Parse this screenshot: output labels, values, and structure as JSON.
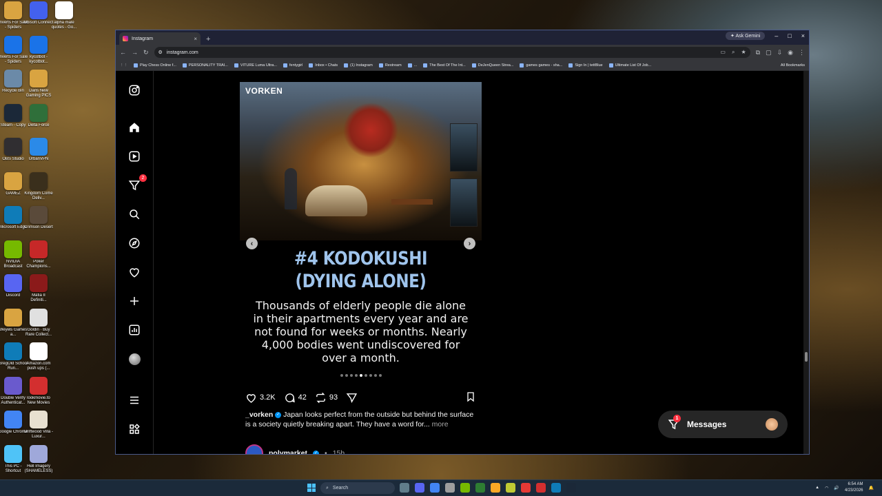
{
  "desktop": {
    "icons": [
      {
        "label": "Inverts For Sale - Spiders",
        "color": "#d9a441"
      },
      {
        "label": "Ubisoft Connect",
        "color": "#4361ee"
      },
      {
        "label": "alpha male quotes - Go...",
        "color": "#ffffff"
      },
      {
        "label": "Inverts For Sale - Spiders",
        "color": "#1a73e8"
      },
      {
        "label": "kycotbot - kycotbot...",
        "color": "#1a73e8"
      },
      {
        "label": "Recycle Bin",
        "color": "#6b8aa8"
      },
      {
        "label": "Dans New Gaming PICS",
        "color": "#d9a441"
      },
      {
        "label": "Steam - Copy",
        "color": "#1b2838"
      },
      {
        "label": "Delta Force",
        "color": "#2f6f3a"
      },
      {
        "label": "OBS Studio",
        "color": "#302e31"
      },
      {
        "label": "UrbanVPN",
        "color": "#2b8ae8"
      },
      {
        "label": "GAMEZ",
        "color": "#d9a441"
      },
      {
        "label": "Kingdom Come Deliv...",
        "color": "#3a2f1c"
      },
      {
        "label": "Microsoft Edge",
        "color": "#0f7cb8"
      },
      {
        "label": "Crimson Desert",
        "color": "#5a4a3a"
      },
      {
        "label": "NVIDIA Broadcast",
        "color": "#76b900"
      },
      {
        "label": "Poker Champions...",
        "color": "#c62828"
      },
      {
        "label": "Discord",
        "color": "#5865f2"
      },
      {
        "label": "Mafia II Definiti...",
        "color": "#8b1a1a"
      },
      {
        "label": "Weyels Games a...",
        "color": "#d9a441"
      },
      {
        "label": "Goldin · Buy Rare Collect...",
        "color": "#e0e0e0"
      },
      {
        "label": "GregOld School Run...",
        "color": "#0f7cb8"
      },
      {
        "label": "Amazon.com push ups (...",
        "color": "#ffffff"
      },
      {
        "label": "Double Verify Authenticat...",
        "color": "#6a5acd"
      },
      {
        "label": "lookmovie.to New Movies",
        "color": "#d32f2f"
      },
      {
        "label": "Google Chrome",
        "color": "#4285f4"
      },
      {
        "label": "Driftwood Villa - Luxur...",
        "color": "#e8e0d0"
      },
      {
        "label": "This PC - Shortcut",
        "color": "#4fc3f7"
      },
      {
        "label": "Hell Imagery (SHAMELESS)",
        "color": "#9fa8da"
      }
    ]
  },
  "browser": {
    "tab_title": "Instagram",
    "tab_close": "×",
    "new_tab": "+",
    "gemini_label": "Ask Gemini",
    "minimize": "–",
    "maximize": "□",
    "close": "×",
    "url": "instagram.com",
    "bookmarks": [
      "Play Chess Online f...",
      "PERSONALITY TRAI...",
      "VITURE Luma Ultra...",
      "fentygirl",
      "Inbox • Chats",
      "(1) Instagram",
      "Restream",
      "...",
      "The Best Of The Int...",
      "DeJenQueen Strea...",
      "games games - sha...",
      "Sign In | tettBlue",
      "Ultimate List Of Job..."
    ],
    "all_bookmarks": "All Bookmarks"
  },
  "instagram": {
    "notifications_badge": "2",
    "post": {
      "brand": "VORKEN",
      "headline_line1": "#4 KODOKUSHI",
      "headline_line2": "(DYING ALONE)",
      "body": "Thousands of elderly people die alone in their apartments every year and are not found for weeks or months. Nearly 4,000 bodies went undiscovered for over a month.",
      "carousel_total": 9,
      "carousel_active": 5,
      "likes": "3.2K",
      "comments": "42",
      "reposts": "93",
      "caption_user": "_vorken",
      "caption_text": "Japan looks perfect from the outside but behind the surface is a society quietly breaking apart. They have a word for...",
      "caption_more": "more"
    },
    "next_post": {
      "user": "polymarket",
      "time": "15h"
    },
    "messages": {
      "label": "Messages",
      "badge": "1"
    }
  },
  "taskbar": {
    "search_placeholder": "Search",
    "time": "6:54 AM",
    "date": "4/23/2026"
  },
  "colors": {
    "accent_blue": "#9fc4ec",
    "badge_red": "#ff3040",
    "verified_blue": "#0095f6"
  }
}
